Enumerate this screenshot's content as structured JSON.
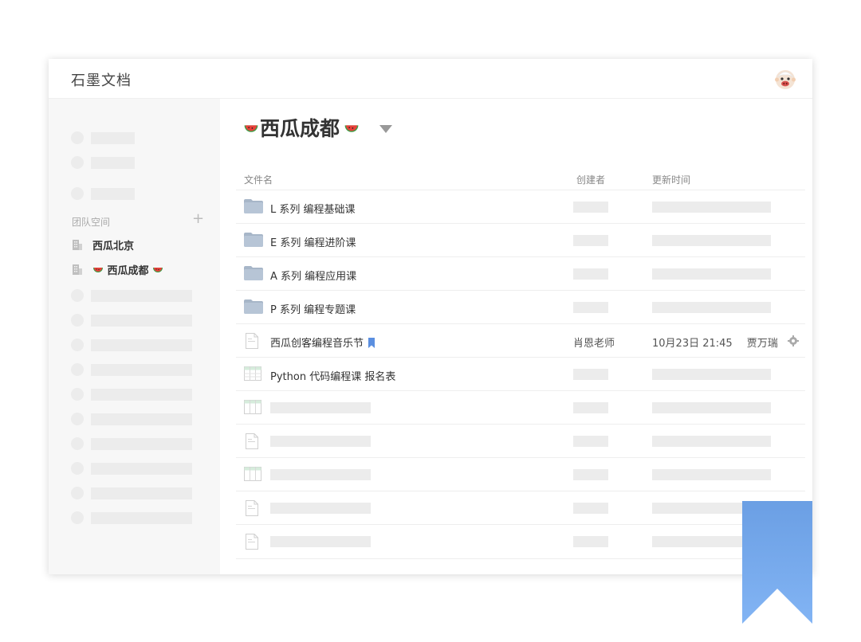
{
  "app": {
    "title": "石墨文档"
  },
  "sidebar": {
    "section_label": "团队空间",
    "add_symbol": "+",
    "teams": [
      {
        "label": "西瓜北京"
      },
      {
        "label": "西瓜成都"
      }
    ]
  },
  "space": {
    "title": "西瓜成都"
  },
  "columns": {
    "name": "文件名",
    "creator": "创建者",
    "updated": "更新时间"
  },
  "files": [
    {
      "type": "folder",
      "name": "L 系列  编程基础课"
    },
    {
      "type": "folder",
      "name": "E 系列  编程进阶课"
    },
    {
      "type": "folder",
      "name": "A 系列  编程应用课"
    },
    {
      "type": "folder",
      "name": "P 系列  编程专题课"
    },
    {
      "type": "doc",
      "name": "西瓜创客编程音乐节",
      "creator": "肖恩老师",
      "updated": "10月23日 21:45",
      "updated_by": "贾万瑞"
    },
    {
      "type": "sheet",
      "name": "Python 代码编程课  报名表"
    }
  ],
  "colors": {
    "accent": "#6a9ee3",
    "ribbon_top": "#6b9fe4",
    "ribbon_bottom": "#7fb1f3",
    "sidebar_bg": "#f7f7f7"
  },
  "icons": [
    "avatar-icon",
    "building-icon",
    "watermelon-icon",
    "caret-down-icon",
    "folder-icon",
    "doc-icon",
    "sheet-icon",
    "bookmark-icon",
    "gear-icon"
  ]
}
